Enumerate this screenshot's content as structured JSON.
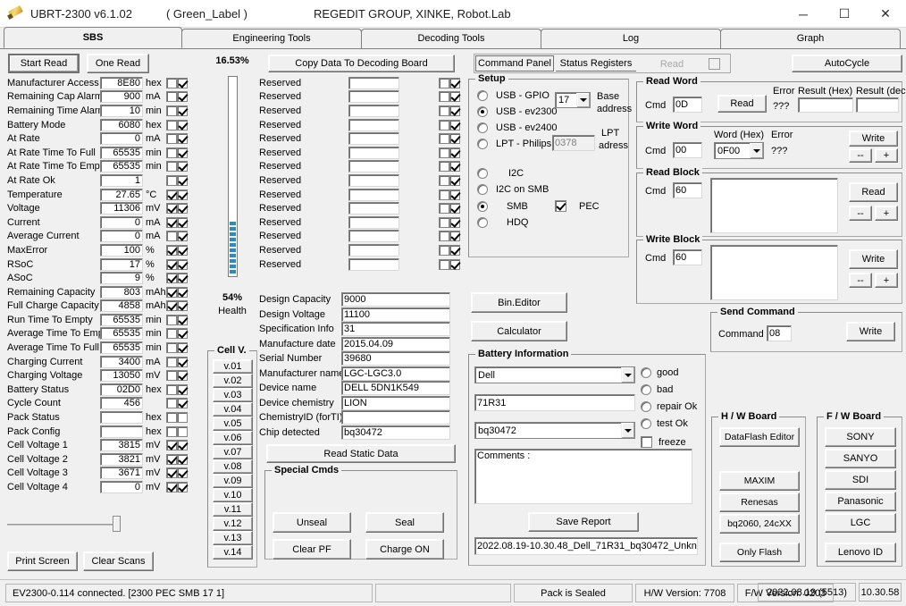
{
  "window": {
    "title": "UBRT-2300 v6.1.02",
    "label": "( Green_Label )",
    "org": "REGEDIT GROUP,  XINKE,  Robot.Lab",
    "minimize": "─",
    "maximize": "☐",
    "close": "✕",
    "icon": "pen-icon"
  },
  "tabs": [
    {
      "label": "SBS",
      "active": true
    },
    {
      "label": "Engineering Tools",
      "active": false
    },
    {
      "label": "Decoding Tools",
      "active": false
    },
    {
      "label": "Log",
      "active": false
    },
    {
      "label": "Graph",
      "active": false
    }
  ],
  "toolbar": {
    "start_read": "Start Read",
    "one_read": "One Read",
    "percent": "16.53%",
    "copy_data": "Copy Data To Decoding Board",
    "command_panel": "Command Panel",
    "status_registers": "Status Registers",
    "read": "Read",
    "autocycle": "AutoCycle"
  },
  "sbs_rows": [
    {
      "name": "Manufacturer Access",
      "value": "8E80",
      "unit": "hex",
      "cb1": false,
      "cb2": true
    },
    {
      "name": "Remaining Cap Alarm",
      "value": "900",
      "unit": "mA",
      "cb1": false,
      "cb2": true
    },
    {
      "name": "Remaining Time Alarm",
      "value": "10",
      "unit": "min",
      "cb1": false,
      "cb2": true
    },
    {
      "name": "Battery Mode",
      "value": "6080",
      "unit": "hex",
      "cb1": false,
      "cb2": true
    },
    {
      "name": "At Rate",
      "value": "0",
      "unit": "mA",
      "cb1": false,
      "cb2": true
    },
    {
      "name": "At Rate Time To Full",
      "value": "65535",
      "unit": "min",
      "cb1": false,
      "cb2": true
    },
    {
      "name": "At Rate Time To Empty",
      "value": "65535",
      "unit": "min",
      "cb1": false,
      "cb2": true
    },
    {
      "name": "At Rate Ok",
      "value": "1",
      "unit": "",
      "cb1": false,
      "cb2": true
    },
    {
      "name": "Temperature",
      "value": "27.65",
      "unit": "°C",
      "cb1": true,
      "cb2": true
    },
    {
      "name": "Voltage",
      "value": "11306",
      "unit": "mV",
      "cb1": true,
      "cb2": true
    },
    {
      "name": "Current",
      "value": "0",
      "unit": "mA",
      "cb1": true,
      "cb2": true
    },
    {
      "name": "Average Current",
      "value": "0",
      "unit": "mA",
      "cb1": false,
      "cb2": true
    },
    {
      "name": "MaxError",
      "value": "100",
      "unit": "%",
      "cb1": true,
      "cb2": true
    },
    {
      "name": "RSoC",
      "value": "17",
      "unit": "%",
      "cb1": true,
      "cb2": true
    },
    {
      "name": "ASoC",
      "value": "9",
      "unit": "%",
      "cb1": true,
      "cb2": true
    },
    {
      "name": "Remaining Capacity",
      "value": "803",
      "unit": "mAh",
      "cb1": true,
      "cb2": true
    },
    {
      "name": "Full Charge Capacity",
      "value": "4858",
      "unit": "mAh",
      "cb1": true,
      "cb2": true
    },
    {
      "name": "Run Time To Empty",
      "value": "65535",
      "unit": "min",
      "cb1": false,
      "cb2": true
    },
    {
      "name": "Average Time To Empty",
      "value": "65535",
      "unit": "min",
      "cb1": false,
      "cb2": true
    },
    {
      "name": "Average Time To Full",
      "value": "65535",
      "unit": "min",
      "cb1": false,
      "cb2": true
    },
    {
      "name": "Charging Current",
      "value": "3400",
      "unit": "mA",
      "cb1": false,
      "cb2": true
    },
    {
      "name": "Charging Voltage",
      "value": "13050",
      "unit": "mV",
      "cb1": false,
      "cb2": true
    },
    {
      "name": "Battery Status",
      "value": "02D0",
      "unit": "hex",
      "cb1": false,
      "cb2": true
    },
    {
      "name": "Cycle Count",
      "value": "456",
      "unit": "",
      "cb1": false,
      "cb2": true
    },
    {
      "name": "Pack Status",
      "value": "",
      "unit": "hex",
      "cb1": false,
      "cb2": false
    },
    {
      "name": "Pack Config",
      "value": "",
      "unit": "hex",
      "cb1": false,
      "cb2": false
    },
    {
      "name": "Cell Voltage 1",
      "value": "3815",
      "unit": "mV",
      "cb1": true,
      "cb2": true
    },
    {
      "name": "Cell Voltage 2",
      "value": "3821",
      "unit": "mV",
      "cb1": true,
      "cb2": true
    },
    {
      "name": "Cell Voltage 3",
      "value": "3671",
      "unit": "mV",
      "cb1": true,
      "cb2": true
    },
    {
      "name": "Cell Voltage 4",
      "value": "0",
      "unit": "mV",
      "cb1": true,
      "cb2": true
    }
  ],
  "reserved_rows": [
    {
      "name": "Reserved",
      "value": "",
      "cb1": false,
      "cb2": true
    },
    {
      "name": "Reserved",
      "value": "",
      "cb1": false,
      "cb2": true
    },
    {
      "name": "Reserved",
      "value": "",
      "cb1": false,
      "cb2": true
    },
    {
      "name": "Reserved",
      "value": "",
      "cb1": false,
      "cb2": true
    },
    {
      "name": "Reserved",
      "value": "",
      "cb1": false,
      "cb2": true
    },
    {
      "name": "Reserved",
      "value": "",
      "cb1": false,
      "cb2": true
    },
    {
      "name": "Reserved",
      "value": "",
      "cb1": false,
      "cb2": true
    },
    {
      "name": "Reserved",
      "value": "",
      "cb1": false,
      "cb2": true
    },
    {
      "name": "Reserved",
      "value": "",
      "cb1": false,
      "cb2": true
    },
    {
      "name": "Reserved",
      "value": "",
      "cb1": false,
      "cb2": true
    },
    {
      "name": "Reserved",
      "value": "",
      "cb1": false,
      "cb2": true
    },
    {
      "name": "Reserved",
      "value": "",
      "cb1": false,
      "cb2": true
    },
    {
      "name": "Reserved",
      "value": "",
      "cb1": false,
      "cb2": true
    },
    {
      "name": "Reserved",
      "value": "",
      "cb1": false,
      "cb2": true
    }
  ],
  "gauge": {
    "percent_label": "16.53%",
    "health_percent": "54%",
    "health_label": "Health",
    "fill_color": "#2e8bb8"
  },
  "static_data": {
    "rows": [
      {
        "name": "Design Capacity",
        "value": "9000"
      },
      {
        "name": "Design Voltage",
        "value": "11100"
      },
      {
        "name": "Specification Info",
        "value": "31"
      },
      {
        "name": "Manufacture date",
        "value": "2015.04.09"
      },
      {
        "name": "Serial Number",
        "value": "39680"
      },
      {
        "name": "Manufacturer name",
        "value": "LGC-LGC3.0"
      },
      {
        "name": "Device name",
        "value": "DELL 5DN1K549"
      },
      {
        "name": "Device chemistry",
        "value": "LION"
      },
      {
        "name": "ChemistryID (forTI)",
        "value": ""
      },
      {
        "name": "Chip detected",
        "value": "bq30472"
      }
    ],
    "read_static_button": "Read Static Data"
  },
  "cell_v": {
    "title": "Cell V.",
    "items": [
      "v.01",
      "v.02",
      "v.03",
      "v.04",
      "v.05",
      "v.06",
      "v.07",
      "v.08",
      "v.09",
      "v.10",
      "v.11",
      "v.12",
      "v.13",
      "v.14"
    ]
  },
  "special_cmds": {
    "title": "Special Cmds",
    "unseal": "Unseal",
    "seal": "Seal",
    "clear_pf": "Clear PF",
    "charge_on": "Charge ON"
  },
  "bottom_left": {
    "print_screen": "Print Screen",
    "clear_scans": "Clear Scans"
  },
  "setup": {
    "title": "Setup",
    "options": [
      {
        "label": "USB - GPIO",
        "selected": false
      },
      {
        "label": "USB - ev2300",
        "selected": true
      },
      {
        "label": "USB - ev2400",
        "selected": false
      },
      {
        "label": "LPT  - Philips",
        "selected": false
      }
    ],
    "base_address_value": "17",
    "base_address_label": "Base\naddress",
    "base_address_label_l1": "Base",
    "base_address_label_l2": "address",
    "lpt_value": "0378",
    "lpt_label_l1": "LPT",
    "lpt_label_l2": "adress",
    "protocols": [
      {
        "label": "I2C",
        "selected": false
      },
      {
        "label": "I2C on SMB",
        "selected": false
      },
      {
        "label": "SMB",
        "selected": true
      },
      {
        "label": "HDQ",
        "selected": false
      }
    ],
    "pec_label": "PEC",
    "pec_checked": true
  },
  "bin_editor": "Bin.Editor",
  "calculator": "Calculator",
  "read_word": {
    "title": "Read Word",
    "cmd_label": "Cmd",
    "cmd_value": "0D",
    "read_button": "Read",
    "error_label": "Error",
    "error_value": "???",
    "result_hex_label": "Result (Hex)",
    "result_hex_value": "",
    "result_dec_label": "Result (dec)",
    "result_dec_value": ""
  },
  "write_word": {
    "title": "Write Word",
    "cmd_label": "Cmd",
    "cmd_value": "00",
    "word_label": "Word (Hex)",
    "word_value": "0F00",
    "error_label": "Error",
    "error_value": "???",
    "write_button": "Write",
    "minus": "--",
    "plus": "+"
  },
  "read_block": {
    "title": "Read Block",
    "cmd_label": "Cmd",
    "cmd_value": "60",
    "content": "",
    "read_button": "Read",
    "minus": "--",
    "plus": "+"
  },
  "write_block": {
    "title": "Write Block",
    "cmd_label": "Cmd",
    "cmd_value": "60",
    "content": "",
    "write_button": "Write",
    "minus": "--",
    "plus": "+"
  },
  "send_command": {
    "title": "Send Command",
    "command_label": "Command",
    "command_value": "08",
    "write_button": "Write"
  },
  "battery_info": {
    "title": "Battery Information",
    "brand": "Dell",
    "model": "71R31",
    "chip": "bq30472",
    "states": [
      {
        "label": "good",
        "selected": false
      },
      {
        "label": "bad",
        "selected": false
      },
      {
        "label": "repair Ok",
        "selected": false
      },
      {
        "label": "test    Ok",
        "selected": false
      }
    ],
    "freeze_label": "freeze",
    "freeze_checked": false,
    "comments_placeholder": "Comments :",
    "save_report": "Save Report",
    "filename": "2022.08.19-10.30.48_Dell_71R31_bq30472_Unkn"
  },
  "hw_board": {
    "title": "H / W  Board",
    "buttons": [
      "DataFlash Editor",
      "MAXIM",
      "Renesas",
      "bq2060, 24cXX",
      "Only Flash"
    ]
  },
  "fw_board": {
    "title": "F / W   Board",
    "buttons": [
      "SONY",
      "SANYO",
      "SDI",
      "Panasonic",
      "LGC",
      "Lenovo ID"
    ]
  },
  "statusbar": {
    "connection": "EV2300-0.114 connected. [2300  PEC  SMB  17 1]",
    "blank": "",
    "seal_state": "Pack is Sealed",
    "hw_version": "H/W Version: 7708",
    "fw_version": "F/W Version: 0203",
    "date": "2022.08.19 (5513)",
    "time": "10.30.58"
  }
}
